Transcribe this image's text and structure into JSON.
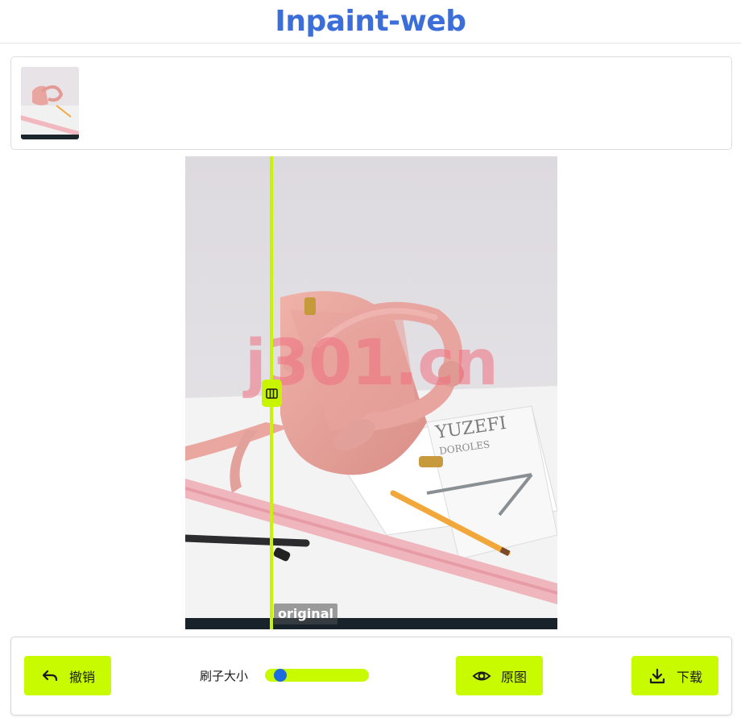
{
  "header": {
    "title": "Inpaint-web"
  },
  "gallery": {
    "thumbnail_icon": "bag-photo-thumbnail"
  },
  "editor": {
    "watermark_text": "j301.cn",
    "original_label": "original",
    "divider_icon": "columns-icon",
    "divider_position": 0.23
  },
  "toolbar": {
    "undo_label": "撤销",
    "undo_icon": "undo-icon",
    "brush_size_label": "刷子大小",
    "brush_size_value": 0.1,
    "original_label": "原图",
    "original_icon": "eye-icon",
    "download_label": "下载",
    "download_icon": "download-icon"
  },
  "colors": {
    "accent": "#c8fb00",
    "title": "#3b6ed8",
    "slider_thumb": "#1e6de0",
    "watermark": "#f07080"
  }
}
